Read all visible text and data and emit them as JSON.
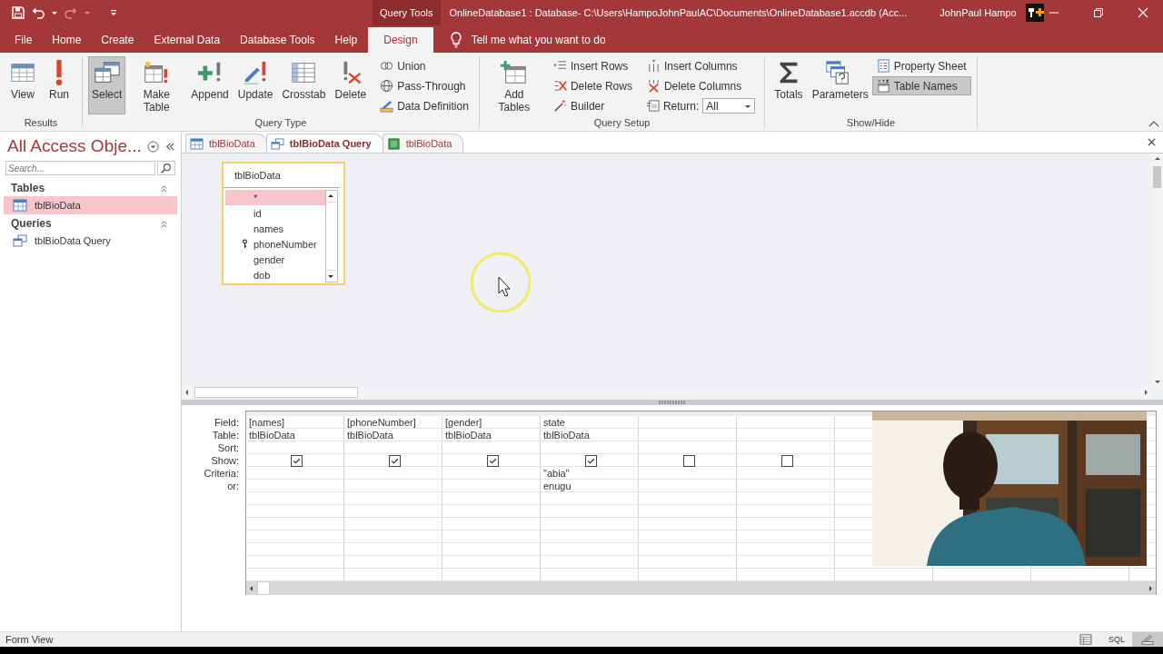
{
  "title_bar": {
    "context_tab": "Query Tools",
    "title": "OnlineDatabase1 : Database- C:\\Users\\HampoJohnPaulAC\\Documents\\OnlineDatabase1.accdb (Acc...",
    "user": "JohnPaul Hampo"
  },
  "menu_tabs": [
    {
      "label": "File",
      "selected": false
    },
    {
      "label": "Home",
      "selected": false
    },
    {
      "label": "Create",
      "selected": false
    },
    {
      "label": "External Data",
      "selected": false
    },
    {
      "label": "Database Tools",
      "selected": false
    },
    {
      "label": "Help",
      "selected": false
    },
    {
      "label": "Design",
      "selected": true
    }
  ],
  "tell_me": "Tell me what you want to do",
  "ribbon": {
    "groups": [
      {
        "label": "Results",
        "items": [
          {
            "kind": "large",
            "label": "View",
            "pressed": false
          },
          {
            "kind": "large",
            "label": "Run",
            "pressed": false
          }
        ]
      },
      {
        "label": "Query Type",
        "items": [
          {
            "kind": "large",
            "label": "Select",
            "pressed": true
          },
          {
            "kind": "large",
            "label": "Make Table",
            "pressed": false
          },
          {
            "kind": "large",
            "label": "Append",
            "pressed": false
          },
          {
            "kind": "large",
            "label": "Update",
            "pressed": false
          },
          {
            "kind": "large",
            "label": "Crosstab",
            "pressed": false
          },
          {
            "kind": "large",
            "label": "Delete",
            "pressed": false
          },
          {
            "kind": "small",
            "label": "Union",
            "pressed": false
          },
          {
            "kind": "small",
            "label": "Pass-Through",
            "pressed": false
          },
          {
            "kind": "small",
            "label": "Data Definition",
            "pressed": false
          }
        ]
      },
      {
        "label": "Query Setup",
        "items": [
          {
            "kind": "large",
            "label": "Add Tables",
            "pressed": false
          },
          {
            "kind": "small",
            "label": "Insert Rows",
            "pressed": false
          },
          {
            "kind": "small",
            "label": "Delete Rows",
            "pressed": false
          },
          {
            "kind": "small",
            "label": "Builder",
            "pressed": false
          },
          {
            "kind": "small",
            "label": "Insert Columns",
            "pressed": false
          },
          {
            "kind": "small",
            "label": "Delete Columns",
            "pressed": false
          },
          {
            "kind": "dropdown",
            "label": "Return:",
            "value": "All"
          }
        ]
      },
      {
        "label": "Show/Hide",
        "items": [
          {
            "kind": "large",
            "label": "Totals",
            "pressed": false
          },
          {
            "kind": "large",
            "label": "Parameters",
            "pressed": false
          },
          {
            "kind": "small",
            "label": "Property Sheet",
            "pressed": false
          },
          {
            "kind": "small",
            "label": "Table Names",
            "pressed": true
          }
        ]
      }
    ]
  },
  "nav": {
    "title": "All Access Obje...",
    "search_placeholder": "Search...",
    "groups": [
      {
        "label": "Tables",
        "items": [
          {
            "label": "tblBioData",
            "kind": "table",
            "selected": true
          }
        ]
      },
      {
        "label": "Queries",
        "items": [
          {
            "label": "tblBioData Query",
            "kind": "query",
            "selected": false
          }
        ]
      }
    ]
  },
  "doc_tabs": [
    {
      "label": "tblBioData",
      "kind": "table",
      "selected": false
    },
    {
      "label": "tblBioData Query",
      "kind": "query",
      "selected": true
    },
    {
      "label": "tblBioData",
      "kind": "form",
      "selected": false
    }
  ],
  "field_list": {
    "title": "tblBioData",
    "fields": [
      {
        "name": "*",
        "primary_key": false,
        "selected": true
      },
      {
        "name": "id",
        "primary_key": false,
        "selected": false
      },
      {
        "name": "names",
        "primary_key": false,
        "selected": false
      },
      {
        "name": "phoneNumber",
        "primary_key": true,
        "selected": false
      },
      {
        "name": "gender",
        "primary_key": false,
        "selected": false
      },
      {
        "name": "dob",
        "primary_key": false,
        "selected": false
      }
    ]
  },
  "grid": {
    "row_labels": [
      "Field:",
      "Table:",
      "Sort:",
      "Show:",
      "Criteria:",
      "or:"
    ],
    "columns": [
      {
        "field": "[names]",
        "table": "tblBioData",
        "show": true
      },
      {
        "field": "[phoneNumber]",
        "table": "tblBioData",
        "show": true
      },
      {
        "field": "[gender]",
        "table": "tblBioData",
        "show": true
      },
      {
        "field": "state",
        "table": "tblBioData",
        "show": true,
        "criteria": "\"abia\"",
        "or": "enugu"
      },
      {
        "show": false
      },
      {
        "show": false
      }
    ]
  },
  "status_bar": {
    "text": "Form View",
    "views": [
      {
        "kind": "datasheet",
        "selected": false
      },
      {
        "kind": "sql",
        "label": "SQL",
        "selected": false
      },
      {
        "kind": "design",
        "selected": true
      }
    ]
  }
}
